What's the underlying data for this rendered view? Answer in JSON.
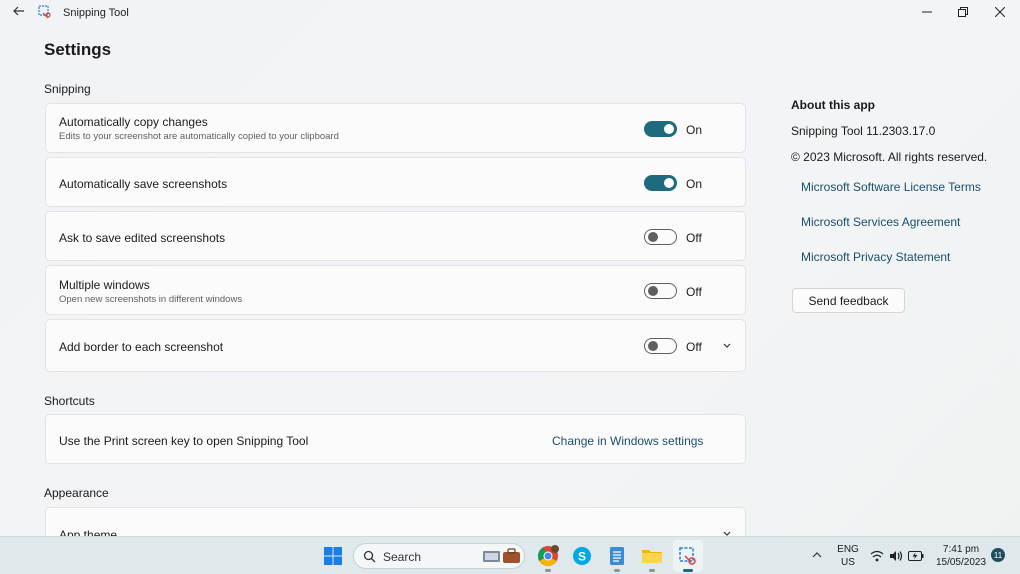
{
  "window": {
    "title": "Snipping Tool"
  },
  "page": {
    "title": "Settings"
  },
  "sections": {
    "snipping": "Snipping",
    "shortcuts": "Shortcuts",
    "appearance": "Appearance"
  },
  "settings": [
    {
      "label": "Automatically copy changes",
      "sub": "Edits to your screenshot are automatically copied to your clipboard",
      "state": "On"
    },
    {
      "label": "Automatically save screenshots",
      "sub": "",
      "state": "On"
    },
    {
      "label": "Ask to save edited screenshots",
      "sub": "",
      "state": "Off"
    },
    {
      "label": "Multiple windows",
      "sub": "Open new screenshots in different windows",
      "state": "Off"
    },
    {
      "label": "Add border to each screenshot",
      "sub": "",
      "state": "Off"
    }
  ],
  "shortcut": {
    "label": "Use the Print screen key to open Snipping Tool",
    "link": "Change in Windows settings"
  },
  "appearance": {
    "label": "App theme"
  },
  "about": {
    "title": "About this app",
    "version": "Snipping Tool 11.2303.17.0",
    "copyright": "© 2023 Microsoft. All rights reserved.",
    "links": [
      "Microsoft Software License Terms",
      "Microsoft Services Agreement",
      "Microsoft Privacy Statement"
    ],
    "feedback": "Send feedback"
  },
  "taskbar": {
    "search": "Search",
    "lang_top": "ENG",
    "lang_bottom": "US",
    "time": "7:41 pm",
    "date": "15/05/2023",
    "notifications": "11"
  },
  "colors": {
    "accent": "#1e6b7d",
    "link": "#1b4e6b"
  }
}
